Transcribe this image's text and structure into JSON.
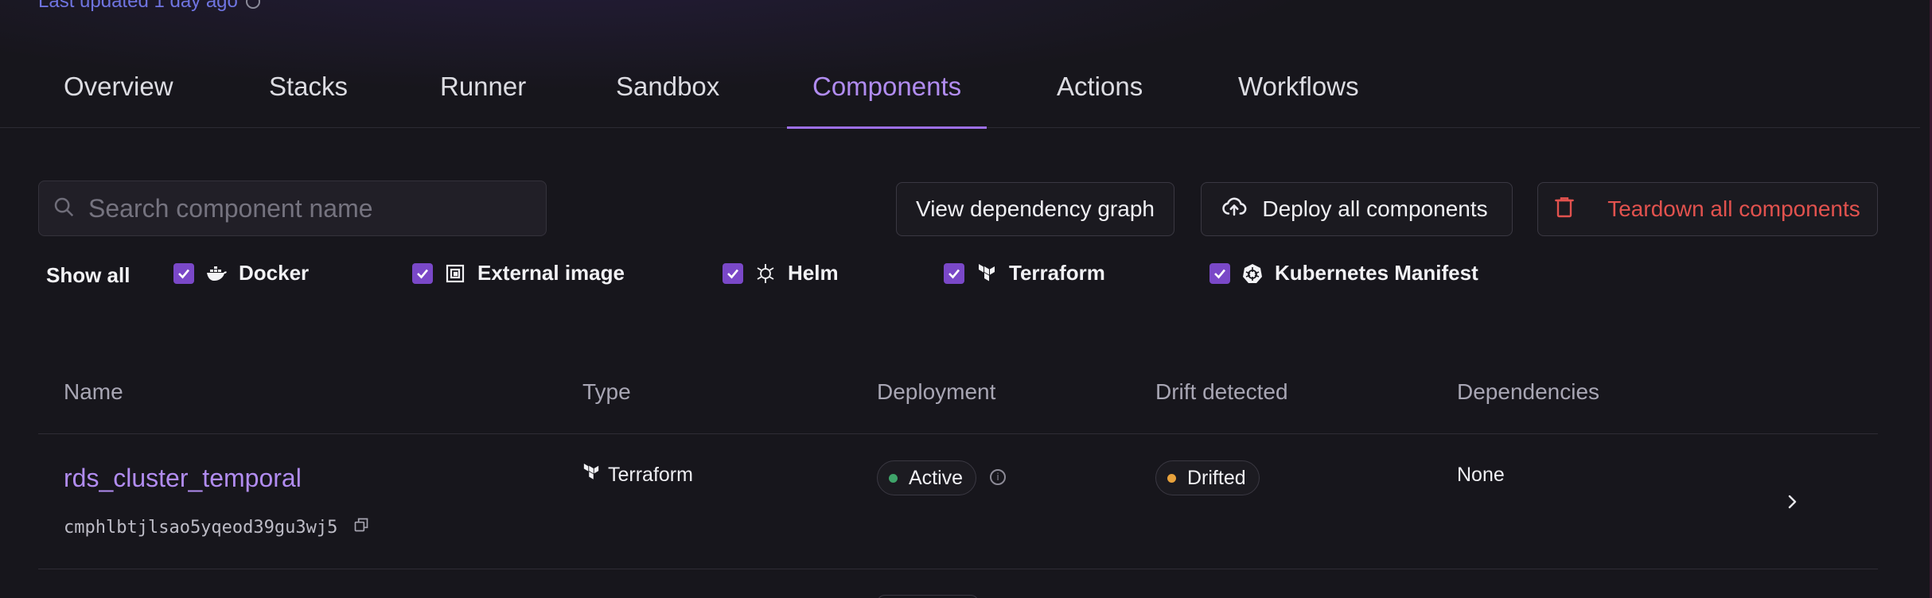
{
  "header": {
    "last_updated": "Last updated 1 day ago"
  },
  "tabs": [
    {
      "label": "Overview",
      "active": false
    },
    {
      "label": "Stacks",
      "active": false
    },
    {
      "label": "Runner",
      "active": false
    },
    {
      "label": "Sandbox",
      "active": false
    },
    {
      "label": "Components",
      "active": true
    },
    {
      "label": "Actions",
      "active": false
    },
    {
      "label": "Workflows",
      "active": false
    }
  ],
  "toolbar": {
    "search_placeholder": "Search component name",
    "search_value": "",
    "dependency_graph_label": "View dependency graph",
    "deploy_all_label": "Deploy all components",
    "teardown_all_label": "Teardown all components"
  },
  "filters": {
    "show_all_label": "Show all",
    "items": [
      {
        "label": "Docker",
        "icon": "docker-icon",
        "checked": true
      },
      {
        "label": "External image",
        "icon": "external-image-icon",
        "checked": true
      },
      {
        "label": "Helm",
        "icon": "helm-icon",
        "checked": true
      },
      {
        "label": "Terraform",
        "icon": "terraform-icon",
        "checked": true
      },
      {
        "label": "Kubernetes Manifest",
        "icon": "kubernetes-icon",
        "checked": true
      }
    ]
  },
  "table": {
    "columns": [
      "Name",
      "Type",
      "Deployment",
      "Drift detected",
      "Dependencies"
    ],
    "rows": [
      {
        "name": "rds_cluster_temporal",
        "id": "cmphlbtjlsao5yqeod39gu3wj5",
        "type": "Terraform",
        "type_icon": "terraform-icon",
        "deployment": "Active",
        "deployment_color": "#3fa46a",
        "drift": "Drifted",
        "drift_color": "#e8a23c",
        "dependencies": "None"
      }
    ]
  },
  "colors": {
    "accent": "#b18cf0",
    "danger": "#e2524e",
    "background": "#17161c"
  }
}
